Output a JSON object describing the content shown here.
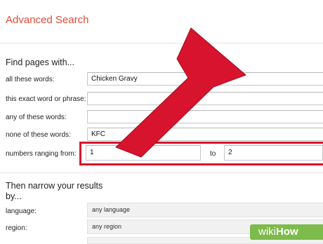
{
  "page": {
    "title": "Advanced Search"
  },
  "find": {
    "heading": "Find pages with...",
    "rows": [
      {
        "label": "all these words:",
        "value": "Chicken Gravy"
      },
      {
        "label": "this exact word or phrase:",
        "value": ""
      },
      {
        "label": "any of these words:",
        "value": ""
      },
      {
        "label": "none of these words:",
        "value": "KFC"
      }
    ],
    "range": {
      "label": "numbers ranging from:",
      "from": "1",
      "to_label": "to",
      "to": "2"
    }
  },
  "narrow": {
    "heading_line1": "Then narrow your results",
    "heading_line2": "by...",
    "rows": [
      {
        "label": "language:",
        "value": "any language"
      },
      {
        "label": "region:",
        "value": "any region"
      }
    ]
  },
  "annotation": {
    "arrow_color": "#d8132e",
    "highlight_color": "#d8132e"
  },
  "watermark": {
    "wiki": "wiki",
    "how": "How"
  }
}
